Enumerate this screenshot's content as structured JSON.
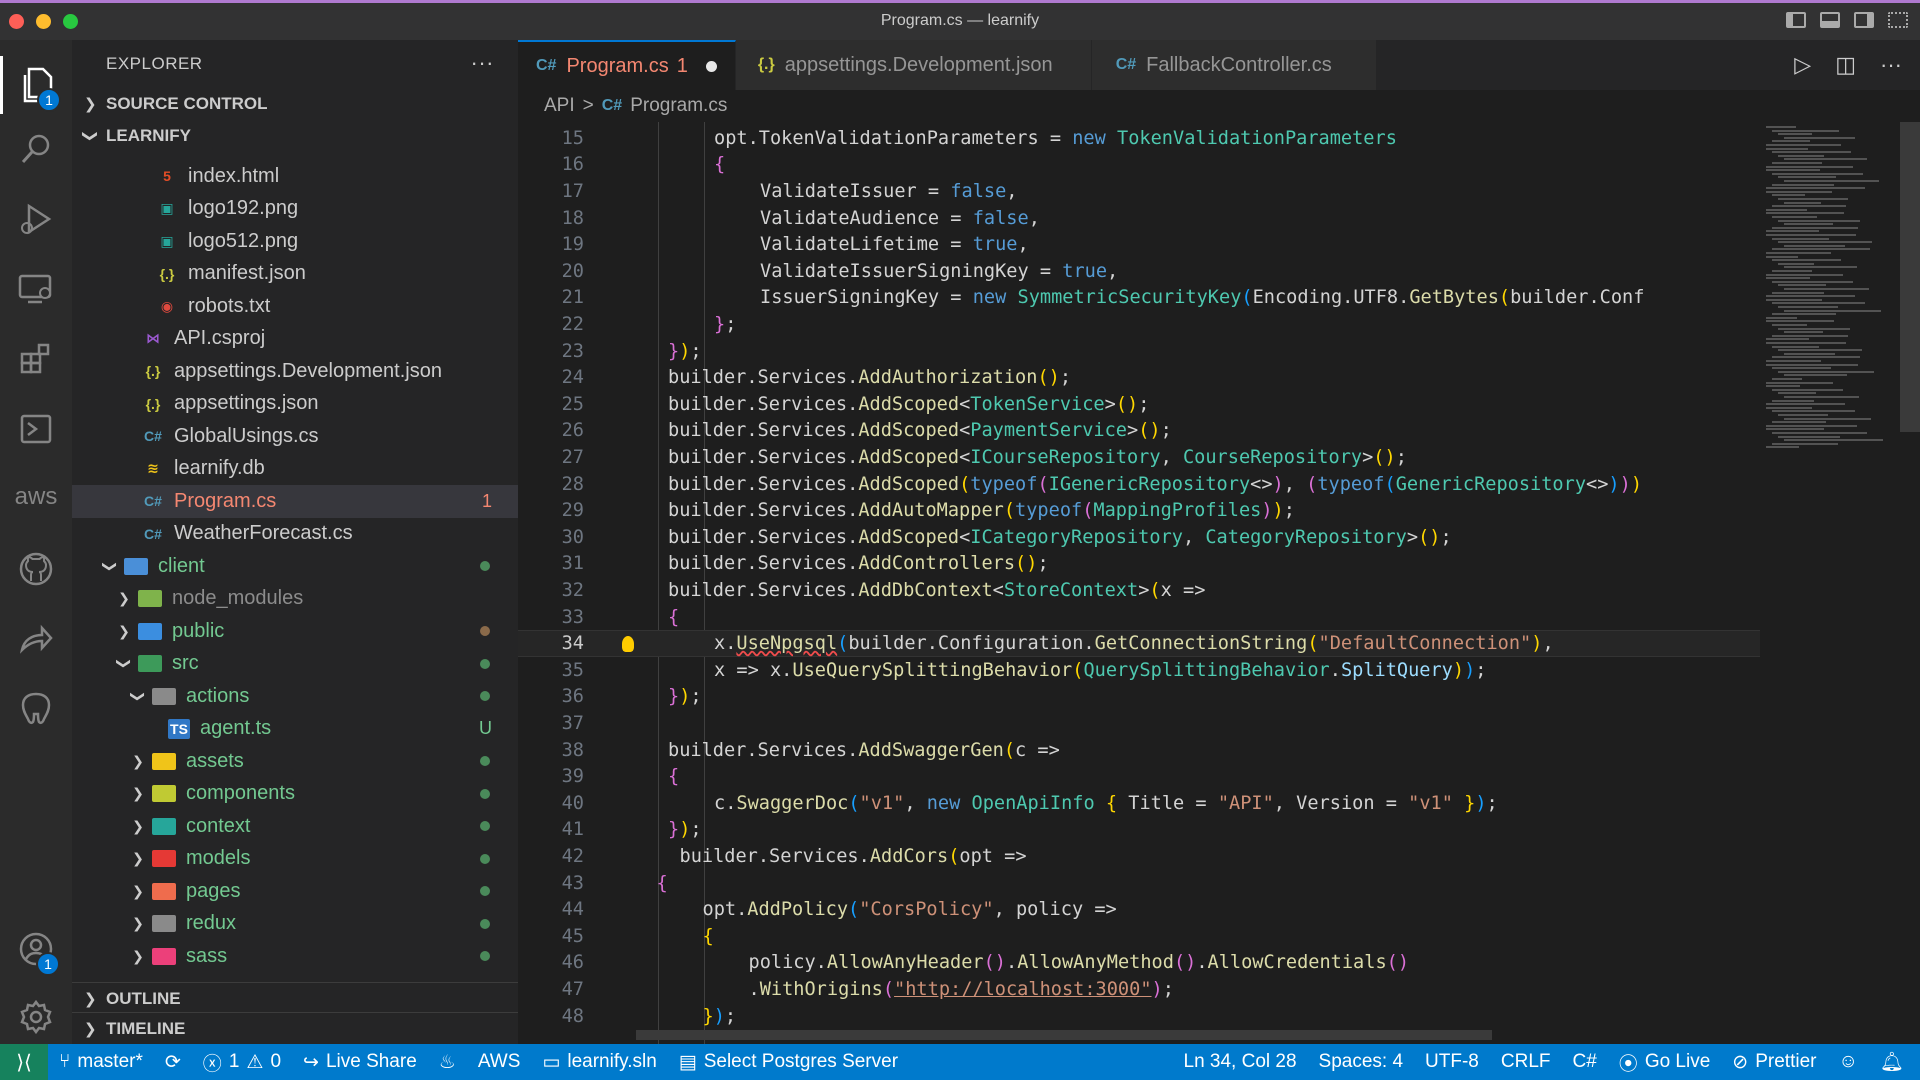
{
  "window": {
    "title": "Program.cs — learnify"
  },
  "activity_bar": {
    "explorer_badge": "1",
    "accounts_badge": "1",
    "aws_label": "aws"
  },
  "explorer": {
    "header": "EXPLORER",
    "more": "···",
    "source_control": "SOURCE CONTROL",
    "project": "LEARNIFY",
    "items": [
      {
        "label": "index.html",
        "icon": "html-icon",
        "glyph": "5"
      },
      {
        "label": "logo192.png",
        "icon": "image-icon",
        "glyph": "▣"
      },
      {
        "label": "logo512.png",
        "icon": "image-icon",
        "glyph": "▣"
      },
      {
        "label": "manifest.json",
        "icon": "json-icon",
        "glyph": "{.}"
      },
      {
        "label": "robots.txt",
        "icon": "robot-icon",
        "glyph": "◉"
      },
      {
        "label": "API.csproj",
        "icon": "csproj-icon",
        "glyph": "⋈"
      },
      {
        "label": "appsettings.Development.json",
        "icon": "json-icon",
        "glyph": "{.}"
      },
      {
        "label": "appsettings.json",
        "icon": "json-icon",
        "glyph": "{.}"
      },
      {
        "label": "GlobalUsings.cs",
        "icon": "csharp-icon",
        "glyph": "C#"
      },
      {
        "label": "learnify.db",
        "icon": "database-icon",
        "glyph": "≋"
      },
      {
        "label": "Program.cs",
        "icon": "csharp-icon",
        "glyph": "C#",
        "decoration": "1"
      },
      {
        "label": "WeatherForecast.cs",
        "icon": "csharp-icon",
        "glyph": "C#"
      },
      {
        "label": "client",
        "icon": "folder-icon"
      },
      {
        "label": "node_modules",
        "icon": "folder-icon"
      },
      {
        "label": "public",
        "icon": "folder-icon"
      },
      {
        "label": "src",
        "icon": "folder-icon"
      },
      {
        "label": "actions",
        "icon": "folder-icon"
      },
      {
        "label": "agent.ts",
        "icon": "typescript-icon",
        "glyph": "TS",
        "decoration": "U"
      },
      {
        "label": "assets",
        "icon": "folder-icon"
      },
      {
        "label": "components",
        "icon": "folder-icon"
      },
      {
        "label": "context",
        "icon": "folder-icon"
      },
      {
        "label": "models",
        "icon": "folder-icon"
      },
      {
        "label": "pages",
        "icon": "folder-icon"
      },
      {
        "label": "redux",
        "icon": "folder-icon"
      },
      {
        "label": "sass",
        "icon": "folder-icon"
      }
    ],
    "outline": "OUTLINE",
    "timeline": "TIMELINE"
  },
  "tabs": [
    {
      "label": "Program.cs",
      "icon_glyph": "C#",
      "modified_count": "1",
      "active": true
    },
    {
      "label": "appsettings.Development.json",
      "icon_glyph": "{.}",
      "active": false
    },
    {
      "label": "FallbackController.cs",
      "icon_glyph": "C#",
      "active": false
    }
  ],
  "breadcrumb": {
    "folder": "API",
    "sep": ">",
    "file_icon": "C#",
    "file": "Program.cs"
  },
  "editor": {
    "current_line": 34,
    "lines": [
      {
        "n": "15",
        "indent": 2,
        "html": "opt.TokenValidationParameters = <span class='k-blue'>new</span> <span class='k-type'>TokenValidationParameters</span>"
      },
      {
        "n": "16",
        "indent": 2,
        "html": "<span class='k-brk2'>{</span>"
      },
      {
        "n": "17",
        "indent": 3,
        "html": "ValidateIssuer = <span class='k-blue'>false</span>,"
      },
      {
        "n": "18",
        "indent": 3,
        "html": "ValidateAudience = <span class='k-blue'>false</span>,"
      },
      {
        "n": "19",
        "indent": 3,
        "html": "ValidateLifetime = <span class='k-blue'>true</span>,"
      },
      {
        "n": "20",
        "indent": 3,
        "html": "ValidateIssuerSigningKey = <span class='k-blue'>true</span>,"
      },
      {
        "n": "21",
        "indent": 3,
        "html": "IssuerSigningKey = <span class='k-blue'>new</span> <span class='k-type'>SymmetricSecurityKey</span><span class='k-brk3'>(</span>Encoding.UTF8.<span class='k-fn'>GetBytes</span><span class='k-brk'>(</span>builder.Conf"
      },
      {
        "n": "22",
        "indent": 2,
        "html": "<span class='k-brk2'>}</span>;"
      },
      {
        "n": "23",
        "indent": 1,
        "html": "<span class='k-brk2'>}</span><span class='k-brk'>)</span>;"
      },
      {
        "n": "24",
        "indent": 1,
        "html": "builder.Services.<span class='k-fn'>AddAuthorization</span><span class='k-brk'>()</span>;"
      },
      {
        "n": "25",
        "indent": 1,
        "html": "builder.Services.<span class='k-fn'>AddScoped</span>&lt;<span class='k-type'>TokenService</span>&gt;<span class='k-brk'>()</span>;"
      },
      {
        "n": "26",
        "indent": 1,
        "html": "builder.Services.<span class='k-fn'>AddScoped</span>&lt;<span class='k-type'>PaymentService</span>&gt;<span class='k-brk'>()</span>;"
      },
      {
        "n": "27",
        "indent": 1,
        "html": "builder.Services.<span class='k-fn'>AddScoped</span>&lt;<span class='k-type'>ICourseRepository</span>, <span class='k-type'>CourseRepository</span>&gt;<span class='k-brk'>()</span>;"
      },
      {
        "n": "28",
        "indent": 1,
        "html": "builder.Services.<span class='k-fn'>AddScoped</span><span class='k-brk'>(</span><span class='k-blue'>typeof</span><span class='k-brk2'>(</span><span class='k-type'>IGenericRepository</span>&lt;&gt;<span class='k-brk2'>)</span>, <span class='k-brk2'>(</span><span class='k-blue'>typeof</span><span class='k-brk3'>(</span><span class='k-type'>GenericRepository</span>&lt;&gt;<span class='k-brk3'>)</span><span class='k-brk2'>)</span><span class='k-brk'>)</span>"
      },
      {
        "n": "29",
        "indent": 1,
        "html": "builder.Services.<span class='k-fn'>AddAutoMapper</span><span class='k-brk'>(</span><span class='k-blue'>typeof</span><span class='k-brk2'>(</span><span class='k-type'>MappingProfiles</span><span class='k-brk2'>)</span><span class='k-brk'>)</span>;"
      },
      {
        "n": "30",
        "indent": 1,
        "html": "builder.Services.<span class='k-fn'>AddScoped</span>&lt;<span class='k-type'>ICategoryRepository</span>, <span class='k-type'>CategoryRepository</span>&gt;<span class='k-brk'>()</span>;"
      },
      {
        "n": "31",
        "indent": 1,
        "html": "builder.Services.<span class='k-fn'>AddControllers</span><span class='k-brk'>()</span>;"
      },
      {
        "n": "32",
        "indent": 1,
        "html": "builder.Services.<span class='k-fn'>AddDbContext</span>&lt;<span class='k-type'>StoreContext</span>&gt;<span class='k-brk'>(</span>x =&gt;"
      },
      {
        "n": "33",
        "indent": 1,
        "html": "<span class='k-brk2'>{</span>"
      },
      {
        "n": "34",
        "indent": 2,
        "html": "x.<span class='k-fn' style='text-decoration: underline wavy #f14c4c;'>UseNpgsql</span><span class='k-brk3'>(</span>builder.Configuration.<span class='k-fn'>GetConnectionString</span><span class='k-brk'>(</span><span class='k-str'>\"DefaultConnection\"</span><span class='k-brk'>)</span>,"
      },
      {
        "n": "35",
        "indent": 2,
        "html": "x =&gt; x.<span class='k-fn'>UseQuerySplittingBehavior</span><span class='k-brk'>(</span><span class='k-type'>QuerySplittingBehavior</span>.<span class='k-prop'>SplitQuery</span><span class='k-brk'>)</span><span class='k-brk3'>)</span>;"
      },
      {
        "n": "36",
        "indent": 1,
        "html": "<span class='k-brk2'>}</span><span class='k-brk'>)</span>;"
      },
      {
        "n": "37",
        "indent": 1,
        "html": ""
      },
      {
        "n": "38",
        "indent": 1,
        "html": "builder.Services.<span class='k-fn'>AddSwaggerGen</span><span class='k-brk'>(</span>c =&gt;"
      },
      {
        "n": "39",
        "indent": 1,
        "html": "<span class='k-brk2'>{</span>"
      },
      {
        "n": "40",
        "indent": 2,
        "html": "c.<span class='k-fn'>SwaggerDoc</span><span class='k-brk3'>(</span><span class='k-str'>\"v1\"</span>, <span class='k-blue'>new</span> <span class='k-type'>OpenApiInfo</span> <span class='k-brk'>{</span> Title = <span class='k-str'>\"API\"</span>, Version = <span class='k-str'>\"v1\"</span> <span class='k-brk'>}</span><span class='k-brk3'>)</span>;"
      },
      {
        "n": "41",
        "indent": 1,
        "html": "<span class='k-brk2'>}</span><span class='k-brk'>)</span>;"
      },
      {
        "n": "42",
        "indent": 1.25,
        "html": "builder.Services.<span class='k-fn'>AddCors</span><span class='k-brk'>(</span>opt =&gt;"
      },
      {
        "n": "43",
        "indent": 0.75,
        "html": "<span class='k-brk2'>{</span>"
      },
      {
        "n": "44",
        "indent": 1.75,
        "html": "opt.<span class='k-fn'>AddPolicy</span><span class='k-brk3'>(</span><span class='k-str'>\"CorsPolicy\"</span>, policy =&gt;"
      },
      {
        "n": "45",
        "indent": 1.75,
        "html": "<span class='k-brk'>{</span>"
      },
      {
        "n": "46",
        "indent": 2.75,
        "html": "policy.<span class='k-fn'>AllowAnyHeader</span><span class='k-brk2'>()</span>.<span class='k-fn'>AllowAnyMethod</span><span class='k-brk2'>()</span>.<span class='k-fn'>AllowCredentials</span><span class='k-brk2'>()</span>"
      },
      {
        "n": "47",
        "indent": 2.75,
        "html": ".<span class='k-fn'>WithOrigins</span><span class='k-brk2'>(</span><span class='k-str' style='text-decoration: underline;'>\"http://localhost:3000\"</span><span class='k-brk2'>)</span>;"
      },
      {
        "n": "48",
        "indent": 1.75,
        "html": "<span class='k-brk'>}</span><span class='k-brk3'>)</span>;"
      }
    ]
  },
  "status": {
    "remote_icon": "⟩⟨",
    "branch": "master*",
    "errors": "1",
    "warnings": "0",
    "live_share": "Live Share",
    "aws": "AWS",
    "solution": "learnify.sln",
    "postgres": "Select Postgres Server",
    "position": "Ln 34, Col 28",
    "spaces": "Spaces: 4",
    "encoding": "UTF-8",
    "eol": "CRLF",
    "language": "C#",
    "go_live": "Go Live",
    "prettier": "Prettier"
  },
  "colors": {
    "accent": "#007acc",
    "tab_modified": "#f48771",
    "git_untracked": "#73c991"
  }
}
